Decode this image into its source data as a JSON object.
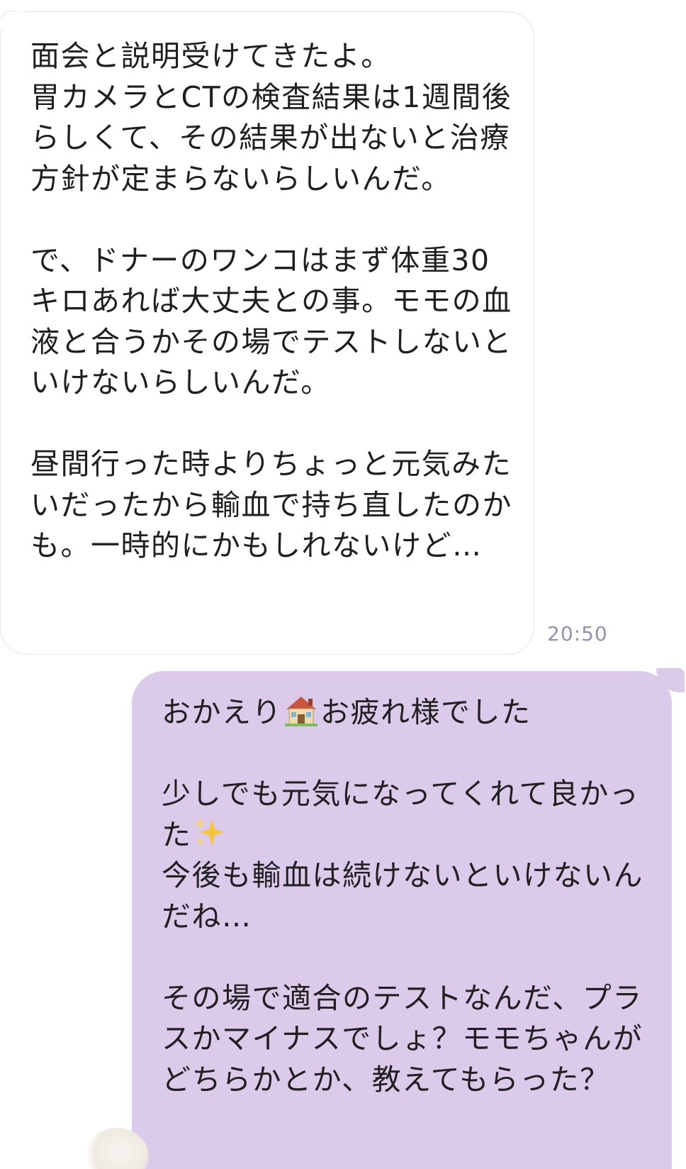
{
  "incoming": {
    "text": "面会と説明受けてきたよ。\n胃カメラとCTの検査結果は1週間後らしくて、その結果が出ないと治療方針が定まらないらしいんだ。\n\nで、ドナーのワンコはまず体重30キロあれば大丈夫との事。モモの血液と合うかその場でテストしないといけないらしいんだ。\n\n昼間行った時よりちょっと元気みたいだったから輸血で持ち直したのかも。一時的にかもしれないけど…",
    "time": "20:50"
  },
  "outgoing": {
    "line1_before": "おかえり",
    "line1_after": "お疲れ様でした",
    "rest_a": "\n\n少しでも元気になってくれて良かった",
    "rest_b": "\n今後も輸血は続けないといけないんだね…\n\nその場で適合のテストなんだ、プラスかマイナスでしょ？モモちゃんがどちらかとか、教えてもらった？",
    "icons": [
      "house-emoji",
      "sparkles-emoji"
    ]
  },
  "colors": {
    "incoming_bubble": "#ffffff",
    "outgoing_bubble": "#dccaeb",
    "timestamp": "#9a8fb3"
  }
}
